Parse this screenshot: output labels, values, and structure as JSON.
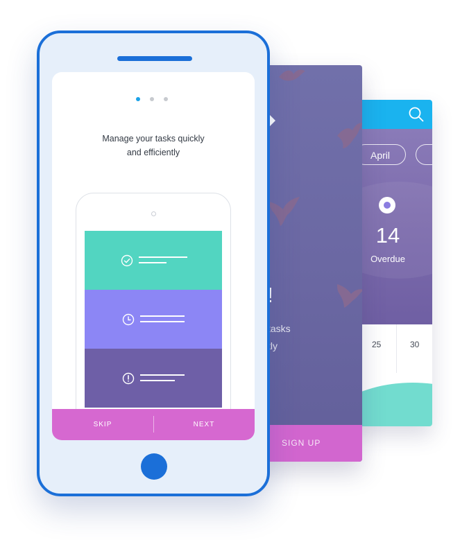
{
  "colors": {
    "phone_frame": "#1b6fd8",
    "accent_blue": "#1aa2e8",
    "bottom_bar": "#d668d0",
    "task_done": "#52d5c1",
    "task_pending": "#8c86f5",
    "task_alert": "#6e5fa7",
    "signup_bar": "#d266cf",
    "calendar_header": "#1ab3ef"
  },
  "onboarding": {
    "page_indicator": {
      "total": 3,
      "active": 1
    },
    "title_line1": "Manage your tasks quickly",
    "title_line2": "and efficiently",
    "tasks": [
      {
        "status": "done",
        "icon": "check-circle-icon"
      },
      {
        "status": "pending",
        "icon": "clock-icon"
      },
      {
        "status": "alert",
        "icon": "exclamation-circle-icon"
      }
    ],
    "skip_label": "SKIP",
    "next_label": "NEXT"
  },
  "signup_screen": {
    "heading": "e!",
    "text_line1": "tasks",
    "text_line2": "tly",
    "signup_label": "SIGN UP"
  },
  "calendar_screen": {
    "months": [
      "April",
      ""
    ],
    "overdue_count": "14",
    "overdue_label": "Overdue",
    "days": [
      "25",
      "30"
    ]
  }
}
